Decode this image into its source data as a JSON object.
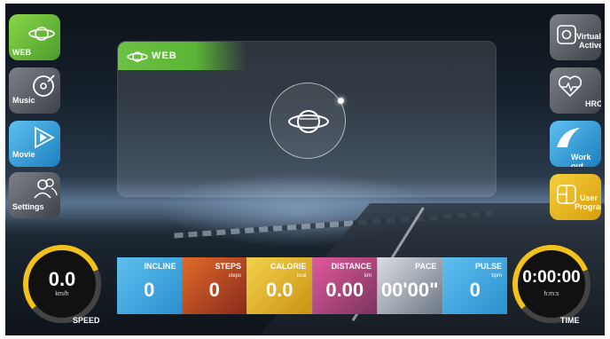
{
  "left_menu": [
    {
      "id": "web",
      "label": "WEB",
      "icon": "web-globe-icon"
    },
    {
      "id": "music",
      "label": "Music",
      "icon": "music-disc-icon"
    },
    {
      "id": "movie",
      "label": "Movie",
      "icon": "movie-play-icon"
    },
    {
      "id": "settings",
      "label": "Settings",
      "icon": "settings-users-icon"
    }
  ],
  "right_menu": [
    {
      "id": "virtual-active",
      "label_line1": "Virtual",
      "label_line2": "Active",
      "icon": "virtual-active-icon"
    },
    {
      "id": "hrc",
      "label_line1": "HRC",
      "label_line2": "",
      "icon": "heart-rate-icon"
    },
    {
      "id": "workout",
      "label_line1": "Work out",
      "label_line2": "",
      "icon": "workout-wave-icon"
    },
    {
      "id": "user-program",
      "label_line1": "User",
      "label_line2": "Program",
      "icon": "user-program-icon"
    }
  ],
  "panel": {
    "title": "WEB"
  },
  "speed": {
    "value": "0.0",
    "unit": "km/h",
    "label": "SPEED",
    "level": 0.55
  },
  "time": {
    "value": "0:00:00",
    "unit": "h:m:s",
    "label": "TIME",
    "level": 0.55
  },
  "stats": {
    "incline": {
      "label": "INCLINE",
      "value": "0",
      "unit": ""
    },
    "steps": {
      "label": "STEPS",
      "value": "0",
      "unit": "steps"
    },
    "calorie": {
      "label": "CALORIE",
      "value": "0.0",
      "unit": "kcal"
    },
    "distance": {
      "label": "DISTANCE",
      "value": "0.00",
      "unit": "km"
    },
    "pace": {
      "label": "PACE",
      "value": "00'00\"",
      "unit": ""
    },
    "pulse": {
      "label": "PULSE",
      "value": "0",
      "unit": "bpm"
    }
  },
  "colors": {
    "green": "#6cc143",
    "blue": "#2a8fcf",
    "yellow": "#f2c21b",
    "grey": "#5b6067"
  }
}
